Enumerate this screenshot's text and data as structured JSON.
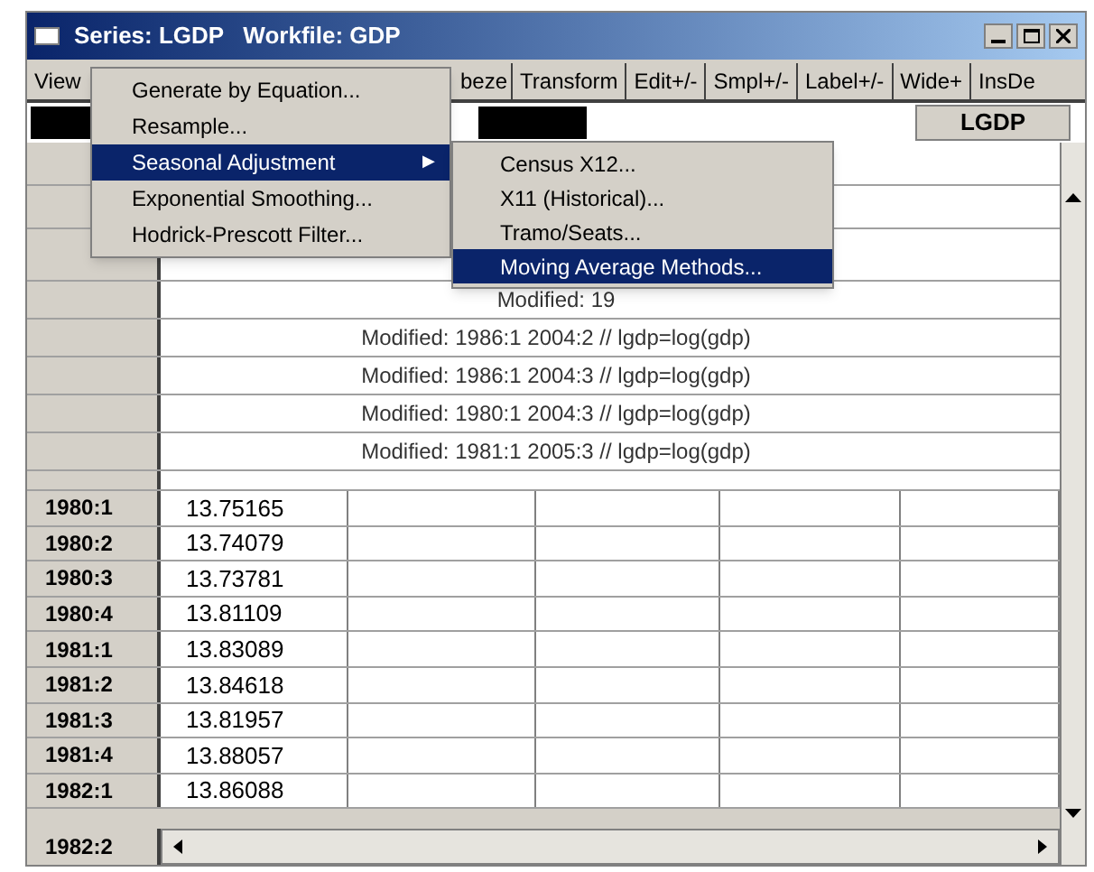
{
  "window": {
    "title": "Series: LGDP   Workfile: GDP"
  },
  "toolbar": [
    {
      "label": "View"
    },
    {
      "label": "beze"
    },
    {
      "label": "Transform"
    },
    {
      "label": "Edit+/-"
    },
    {
      "label": "Smpl+/-"
    },
    {
      "label": "Label+/-"
    },
    {
      "label": "Wide+"
    },
    {
      "label": "InsDe"
    }
  ],
  "series_header": "LGDP",
  "menu": {
    "items": [
      {
        "label": "Generate by Equation...",
        "selected": false,
        "submenu": false
      },
      {
        "label": "Resample...",
        "selected": false,
        "submenu": false
      },
      {
        "label": "Seasonal Adjustment",
        "selected": true,
        "submenu": true
      },
      {
        "label": "Exponential Smoothing...",
        "selected": false,
        "submenu": false
      },
      {
        "label": "Hodrick-Prescott Filter...",
        "selected": false,
        "submenu": false
      }
    ],
    "submenu_arrow": "▶"
  },
  "submenu": {
    "items": [
      {
        "label": "Census X12...",
        "selected": false
      },
      {
        "label": "X11 (Historical)...",
        "selected": false
      },
      {
        "label": "Tramo/Seats...",
        "selected": false
      },
      {
        "label": "Moving Average Methods...",
        "selected": true
      }
    ]
  },
  "table": {
    "comments": [
      "Modified: 19",
      "Modified: 1986:1 2004:2 // lgdp=log(gdp)",
      "Modified: 1986:1 2004:3 // lgdp=log(gdp)",
      "Modified: 1980:1 2004:3 // lgdp=log(gdp)",
      "Modified: 1981:1 2005:3 // lgdp=log(gdp)"
    ],
    "rows": [
      {
        "label": "1980:1",
        "value": "13.75165"
      },
      {
        "label": "1980:2",
        "value": "13.74079"
      },
      {
        "label": "1980:3",
        "value": "13.73781"
      },
      {
        "label": "1980:4",
        "value": "13.81109"
      },
      {
        "label": "1981:1",
        "value": "13.83089"
      },
      {
        "label": "1981:2",
        "value": "13.84618"
      },
      {
        "label": "1981:3",
        "value": "13.81957"
      },
      {
        "label": "1981:4",
        "value": "13.88057"
      },
      {
        "label": "1982:1",
        "value": "13.86088"
      },
      {
        "label": "1982:2"
      }
    ]
  }
}
